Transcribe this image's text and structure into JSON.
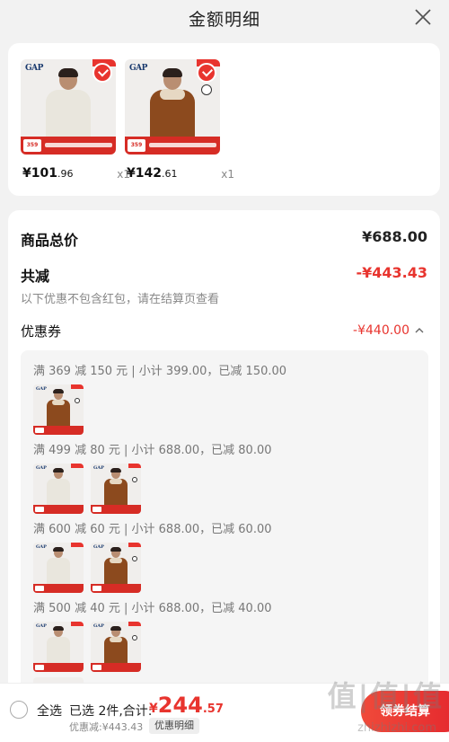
{
  "header": {
    "title": "金额明细",
    "close_icon": "close-icon"
  },
  "products": [
    {
      "price_int": "¥101",
      "price_dec": ".96",
      "qty": "x1",
      "tag": "359",
      "style": "hoodie"
    },
    {
      "price_int": "¥142",
      "price_dec": ".61",
      "qty": "x1",
      "tag": "359",
      "style": "jacket"
    }
  ],
  "brand": "GAP",
  "summary": {
    "total_label": "商品总价",
    "total_value": "¥688.00",
    "discount_label": "共减",
    "discount_value": "-¥443.43",
    "note": "以下优惠不包含红包，请在结算页查看",
    "coupon_label": "优惠券",
    "coupon_value": "-¥440.00"
  },
  "coupon_groups": [
    {
      "text": "满 369 减 150 元 | 小计 399.00，已减 150.00",
      "items": [
        "jacket"
      ]
    },
    {
      "text": "满 499 减 80 元 | 小计 688.00，已减 80.00",
      "items": [
        "hoodie",
        "jacket"
      ]
    },
    {
      "text": "满 600 减 60 元 | 小计 688.00，已减 60.00",
      "items": [
        "hoodie",
        "jacket"
      ]
    },
    {
      "text": "满 500 减 40 元 | 小计 688.00，已减 40.00",
      "items": [
        "hoodie",
        "jacket"
      ]
    }
  ],
  "footer": {
    "select_all": "全选",
    "selected": "已选 2件,合计:",
    "total_currency": "¥",
    "total_int": "244",
    "total_dec": ".57",
    "saved": "优惠减:¥443.43",
    "detail_link": "优惠明细",
    "checkout": "领券结算"
  },
  "watermark": {
    "main": "值|值|值",
    "url": "zhizhizhi.com"
  },
  "colors": {
    "accent": "#e8342e",
    "background": "#f2f2f2"
  }
}
